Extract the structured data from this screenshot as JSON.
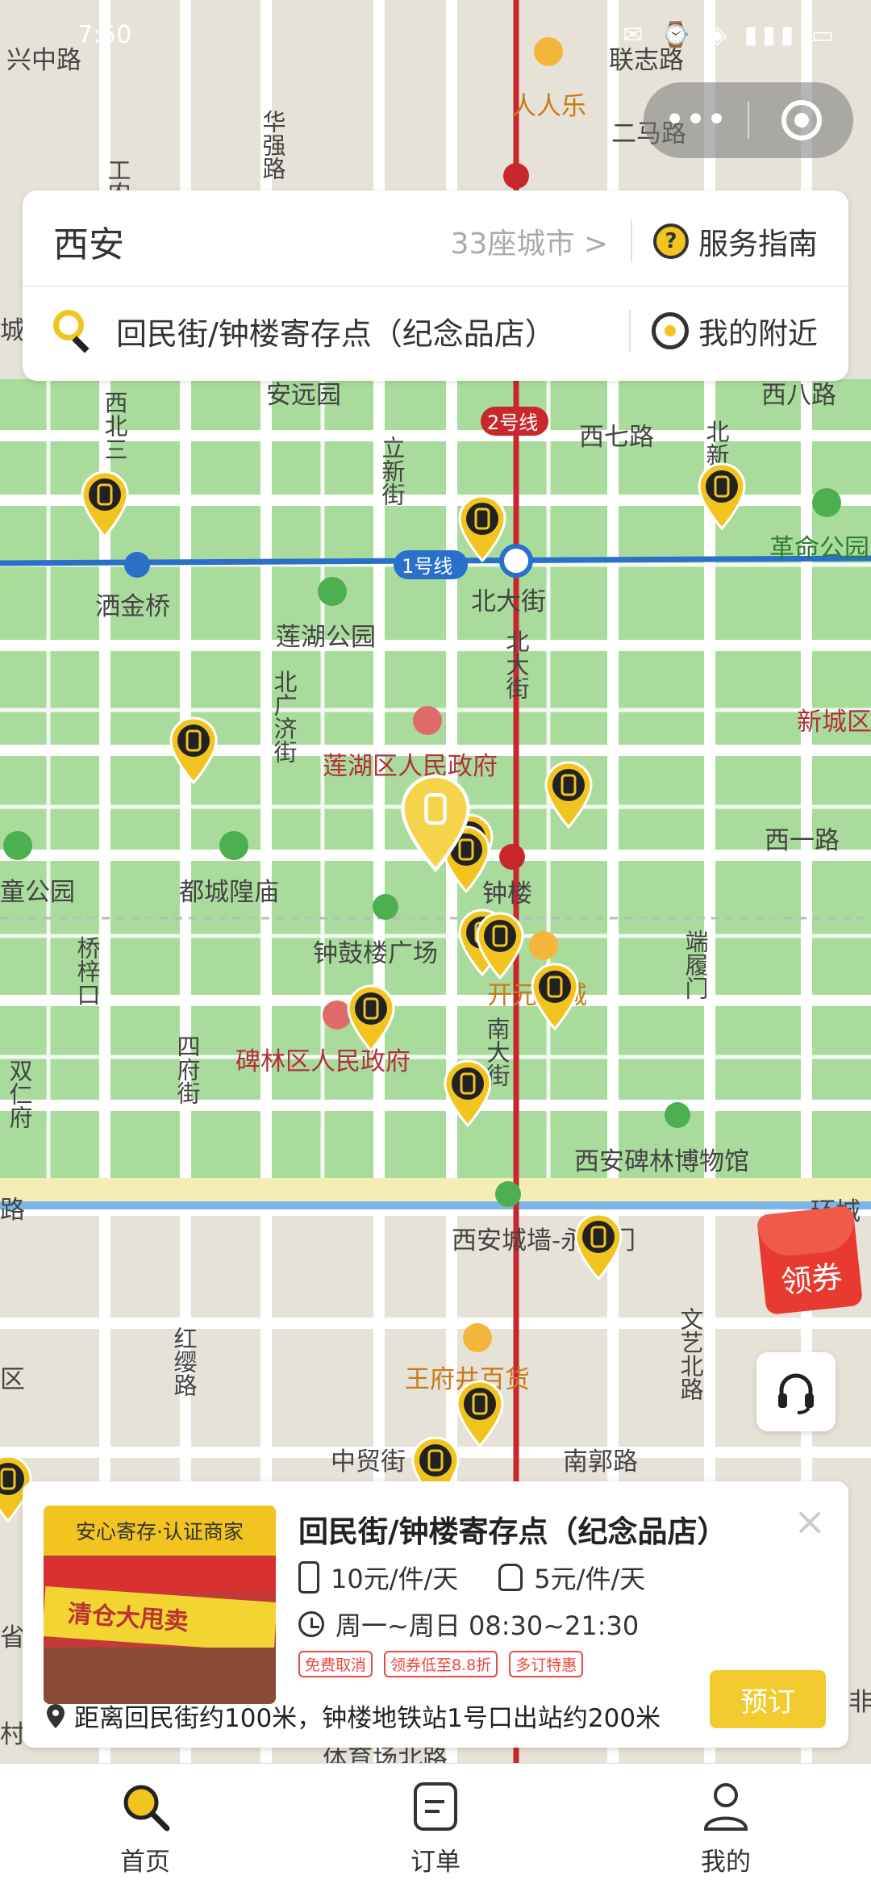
{
  "status_bar": {
    "time": "7:50",
    "icons": "✉ ⌚ ◈ ▮▮▮ ▭"
  },
  "capsule": {
    "more_label": "•••"
  },
  "header": {
    "city": "西安",
    "city_count": "33座城市 >",
    "guide_label": "服务指南",
    "search_text": "回民街/钟楼寄存点（纪念品店）",
    "nearby_label": "我的附近"
  },
  "map_labels": {
    "l1": "兴中路",
    "l2": "联志路",
    "l3": "人人乐",
    "l4": "二马路",
    "l5": "华强路",
    "l6": "工农",
    "l7": "安远园",
    "l8": "西八路",
    "l9": "2号线",
    "l10": "西七路",
    "l11": "西北三",
    "l12": "立新街",
    "l13": "北新",
    "l14": "洒金桥",
    "l15": "1号线",
    "l16": "北大街",
    "l17": "革命公园",
    "l18": "莲湖公园",
    "l19": "北大街",
    "l20": "北广济街",
    "l21": "新城区",
    "l22": "莲湖区人民政府",
    "l23": "西一路",
    "l24": "童公园",
    "l25": "都城隍庙",
    "l26": "钟楼",
    "l27": "钟鼓楼广场",
    "l28": "桥梓口",
    "l29": "开元商城",
    "l30": "端履门",
    "l31": "四府街",
    "l32": "碑林区人民政府",
    "l33": "南大街",
    "l34": "双仁府",
    "l35": "西安碑林博物馆",
    "l36": "路",
    "l37": "环城",
    "l38": "西安城墙-永宁门",
    "l39": "红缨路",
    "l40": "王府井百货",
    "l41": "文艺北路",
    "l42": "中贸街",
    "l43": "南郭路",
    "l44": "体育场北路",
    "l45": "城",
    "l46": "区",
    "l47": "省",
    "l48": "村",
    "l49": "非"
  },
  "coupon": {
    "label": "领券"
  },
  "store": {
    "badge": "安心寄存·认证商家",
    "photo_text": "清仓大甩卖",
    "name": "回民街/钟楼寄存点（纪念品店）",
    "price_luggage": "10元/件/天",
    "price_bag": "5元/件/天",
    "hours": "周一~周日 08:30~21:30",
    "tags": [
      "免费取消",
      "领券低至8.8折",
      "多订特惠"
    ],
    "distance": "距离回民街约100米，钟楼地铁站1号口出站约200米",
    "book_label": "预订",
    "close_label": "×"
  },
  "tabbar": {
    "home": "首页",
    "orders": "订单",
    "mine": "我的"
  },
  "colors": {
    "accent": "#f1c41f",
    "park": "#a8dc9b",
    "metro_red": "#c8282d",
    "metro_blue": "#2a6fc9"
  }
}
